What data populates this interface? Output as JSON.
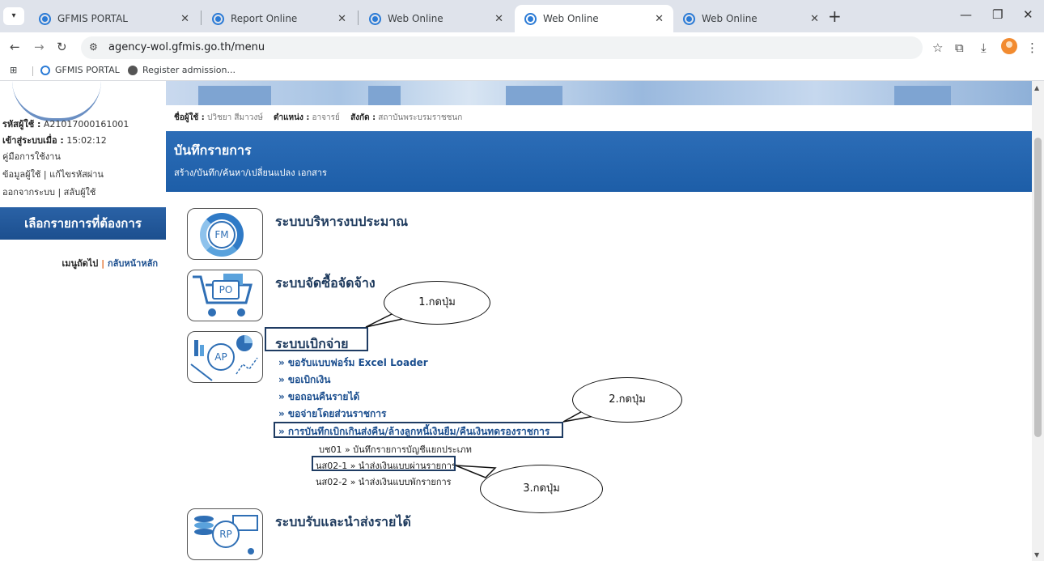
{
  "browser": {
    "tabs": [
      {
        "label": "GFMIS PORTAL",
        "active": false
      },
      {
        "label": "Report Online",
        "active": false
      },
      {
        "label": "Web Online",
        "active": false
      },
      {
        "label": "Web Online",
        "active": true
      },
      {
        "label": "Web Online",
        "active": false
      }
    ],
    "url": "agency-wol.gfmis.go.th/menu",
    "bookmarks": [
      "GFMIS PORTAL",
      "Register admission..."
    ]
  },
  "sidebar": {
    "user_code_label": "รหัสผู้ใช้ :",
    "user_code": "A21017000161001",
    "login_label": "เข้าสู่ระบบเมื่อ :",
    "login_time": "15:02:12",
    "manual": "คู่มือการใช้งาน",
    "user_info": "ข้อมูลผู้ใช้",
    "change_password": "แก้ไขรหัสผ่าน",
    "logout": "ออกจากระบบ",
    "switch_user": "สลับผู้ใช้",
    "menu_header": "เลือกรายการที่ต้องการ",
    "next_menu": "เมนูถัดไป",
    "nav_pipe": "|",
    "back_home": "กลับหน้าหลัก"
  },
  "userline": {
    "name_label": "ชื่อผู้ใช้ :",
    "name": "ปวิชยา สีมาวงษ์",
    "position_label": "ตำแหน่ง :",
    "position": "อาจารย์",
    "org_label": "สังกัด :",
    "org": "สถาบันพระบรมราชชนก"
  },
  "page": {
    "title": "บันทึกรายการ",
    "subtitle": "สร้าง/บันทึก/ค้นหา/เปลี่ยนแปลง เอกสาร"
  },
  "modules": {
    "fm": {
      "icon_text": "FM",
      "title": "ระบบบริหารงบประมาณ"
    },
    "po": {
      "icon_text": "PO",
      "title": "ระบบจัดซื้อจัดจ้าง"
    },
    "ap": {
      "icon_text": "AP",
      "title": "ระบบเบิกจ่าย",
      "links": [
        "» ขอรับแบบฟอร์ม Excel Loader",
        "» ขอเบิกเงิน",
        "» ขอถอนคืนรายได้",
        "» ขอจ่ายโดยส่วนราชการ",
        "» การบันทึกเบิกเกินส่งคืน/ล้างลูกหนี้เงินยืม/คืนเงินทดรองราชการ"
      ],
      "sublinks": [
        "บช01 » บันทึกรายการบัญชีแยกประเภท",
        "นส02-1 » นำส่งเงินแบบผ่านรายการ",
        "นส02-2 » นำส่งเงินแบบพักรายการ"
      ]
    },
    "rp": {
      "icon_text": "RP",
      "title": "ระบบรับและนำส่งรายได้"
    }
  },
  "callouts": [
    "1.กดปุ่ม",
    "2.กดปุ่ม",
    "3.กดปุ่ม"
  ],
  "colors": {
    "primary": "#1d5ea8",
    "link": "#1c4f8f",
    "highlight_border": "#1f3c63"
  }
}
